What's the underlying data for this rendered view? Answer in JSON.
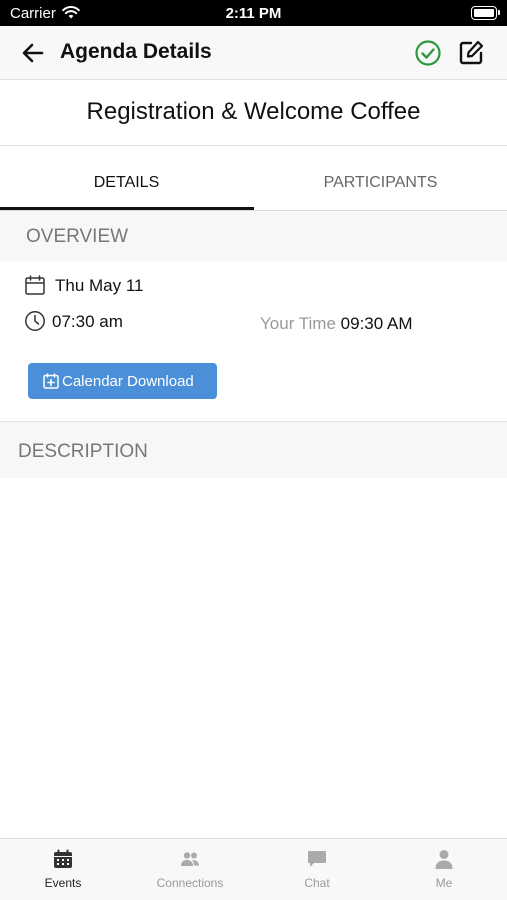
{
  "status_bar": {
    "carrier": "Carrier",
    "time": "2:11 PM"
  },
  "navbar": {
    "title": "Agenda Details"
  },
  "event": {
    "title": "Registration & Welcome Coffee"
  },
  "tabs": [
    {
      "label": "DETAILS",
      "active": true
    },
    {
      "label": "PARTICIPANTS",
      "active": false
    }
  ],
  "overview": {
    "heading": "OVERVIEW",
    "date": "Thu May 11",
    "time": "07:30 am",
    "your_time_label": "Your Time",
    "your_time_value": "09:30 AM",
    "calendar_button": "Calendar Download"
  },
  "description": {
    "heading": "DESCRIPTION"
  },
  "tabbar": {
    "items": [
      {
        "label": "Events",
        "icon": "calendar-icon",
        "active": true
      },
      {
        "label": "Connections",
        "icon": "people-icon",
        "active": false
      },
      {
        "label": "Chat",
        "icon": "chat-icon",
        "active": false
      },
      {
        "label": "Me",
        "icon": "person-icon",
        "active": false
      }
    ]
  },
  "colors": {
    "accent": "#4a8fd8",
    "check": "#2a9a3a",
    "active_tab": "#111111"
  }
}
